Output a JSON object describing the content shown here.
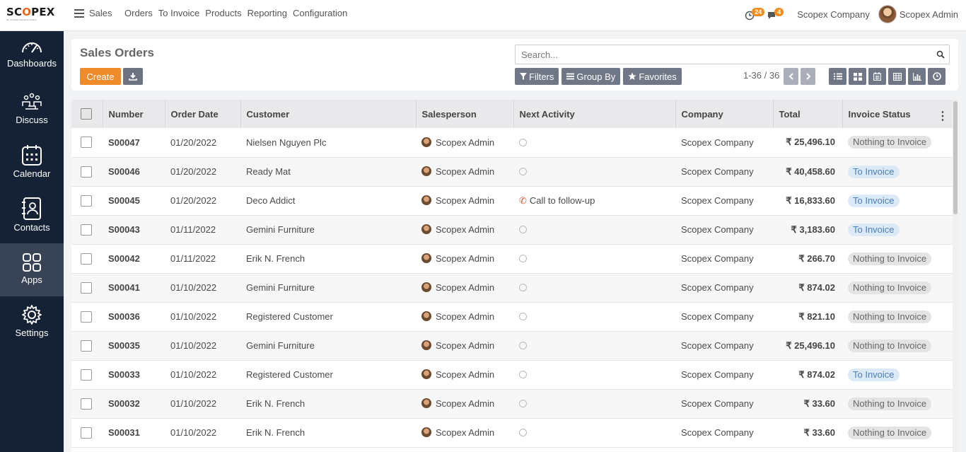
{
  "brand": {
    "logo_main": "SC",
    "logo_o": "O",
    "logo_rest": "PEX",
    "logo_tagline": "the complete enterprise solution"
  },
  "topbar": {
    "app_name": "Sales",
    "menu": [
      "Orders",
      "To Invoice",
      "Products",
      "Reporting",
      "Configuration"
    ],
    "activity_count": "24",
    "message_count": "4",
    "company": "Scopex Company",
    "user": "Scopex Admin"
  },
  "sidebar": [
    {
      "label": "Dashboards",
      "icon": "dashboard-icon"
    },
    {
      "label": "Discuss",
      "icon": "discuss-icon"
    },
    {
      "label": "Calendar",
      "icon": "calendar-icon"
    },
    {
      "label": "Contacts",
      "icon": "contacts-icon"
    },
    {
      "label": "Apps",
      "icon": "apps-icon",
      "active": true
    },
    {
      "label": "Settings",
      "icon": "settings-icon"
    }
  ],
  "control": {
    "title": "Sales Orders",
    "create_label": "Create",
    "search_placeholder": "Search...",
    "filters_label": "Filters",
    "groupby_label": "Group By",
    "favorites_label": "Favorites",
    "pager": "1-36 / 36"
  },
  "table": {
    "headers": [
      "Number",
      "Order Date",
      "Customer",
      "Salesperson",
      "Next Activity",
      "Company",
      "Total",
      "Invoice Status"
    ],
    "rows": [
      {
        "number": "S00047",
        "date": "01/20/2022",
        "customer": "Nielsen Nguyen Plc",
        "salesperson": "Scopex Admin",
        "activity": "",
        "company": "Scopex Company",
        "total": "₹ 25,496.10",
        "status": "Nothing to Invoice"
      },
      {
        "number": "S00046",
        "date": "01/20/2022",
        "customer": "Ready Mat",
        "salesperson": "Scopex Admin",
        "activity": "",
        "company": "Scopex Company",
        "total": "₹ 40,458.60",
        "status": "To Invoice"
      },
      {
        "number": "S00045",
        "date": "01/20/2022",
        "customer": "Deco Addict",
        "salesperson": "Scopex Admin",
        "activity": "Call to follow-up",
        "company": "Scopex Company",
        "total": "₹ 16,833.60",
        "status": "To Invoice"
      },
      {
        "number": "S00043",
        "date": "01/11/2022",
        "customer": "Gemini Furniture",
        "salesperson": "Scopex Admin",
        "activity": "",
        "company": "Scopex Company",
        "total": "₹ 3,183.60",
        "status": "To Invoice"
      },
      {
        "number": "S00042",
        "date": "01/11/2022",
        "customer": "Erik N. French",
        "salesperson": "Scopex Admin",
        "activity": "",
        "company": "Scopex Company",
        "total": "₹ 266.70",
        "status": "Nothing to Invoice"
      },
      {
        "number": "S00041",
        "date": "01/10/2022",
        "customer": "Gemini Furniture",
        "salesperson": "Scopex Admin",
        "activity": "",
        "company": "Scopex Company",
        "total": "₹ 874.02",
        "status": "Nothing to Invoice"
      },
      {
        "number": "S00036",
        "date": "01/10/2022",
        "customer": "Registered Customer",
        "salesperson": "Scopex Admin",
        "activity": "",
        "company": "Scopex Company",
        "total": "₹ 821.10",
        "status": "Nothing to Invoice"
      },
      {
        "number": "S00035",
        "date": "01/10/2022",
        "customer": "Gemini Furniture",
        "salesperson": "Scopex Admin",
        "activity": "",
        "company": "Scopex Company",
        "total": "₹ 25,496.10",
        "status": "Nothing to Invoice"
      },
      {
        "number": "S00033",
        "date": "01/10/2022",
        "customer": "Registered Customer",
        "salesperson": "Scopex Admin",
        "activity": "",
        "company": "Scopex Company",
        "total": "₹ 874.02",
        "status": "To Invoice"
      },
      {
        "number": "S00032",
        "date": "01/10/2022",
        "customer": "Erik N. French",
        "salesperson": "Scopex Admin",
        "activity": "",
        "company": "Scopex Company",
        "total": "₹ 33.60",
        "status": "Nothing to Invoice"
      },
      {
        "number": "S00031",
        "date": "01/10/2022",
        "customer": "Erik N. French",
        "salesperson": "Scopex Admin",
        "activity": "",
        "company": "Scopex Company",
        "total": "₹ 33.60",
        "status": "Nothing to Invoice"
      }
    ]
  },
  "colors": {
    "accent": "#f08b2a",
    "sidebar_bg": "#152236",
    "sidebar_active": "#384456"
  }
}
